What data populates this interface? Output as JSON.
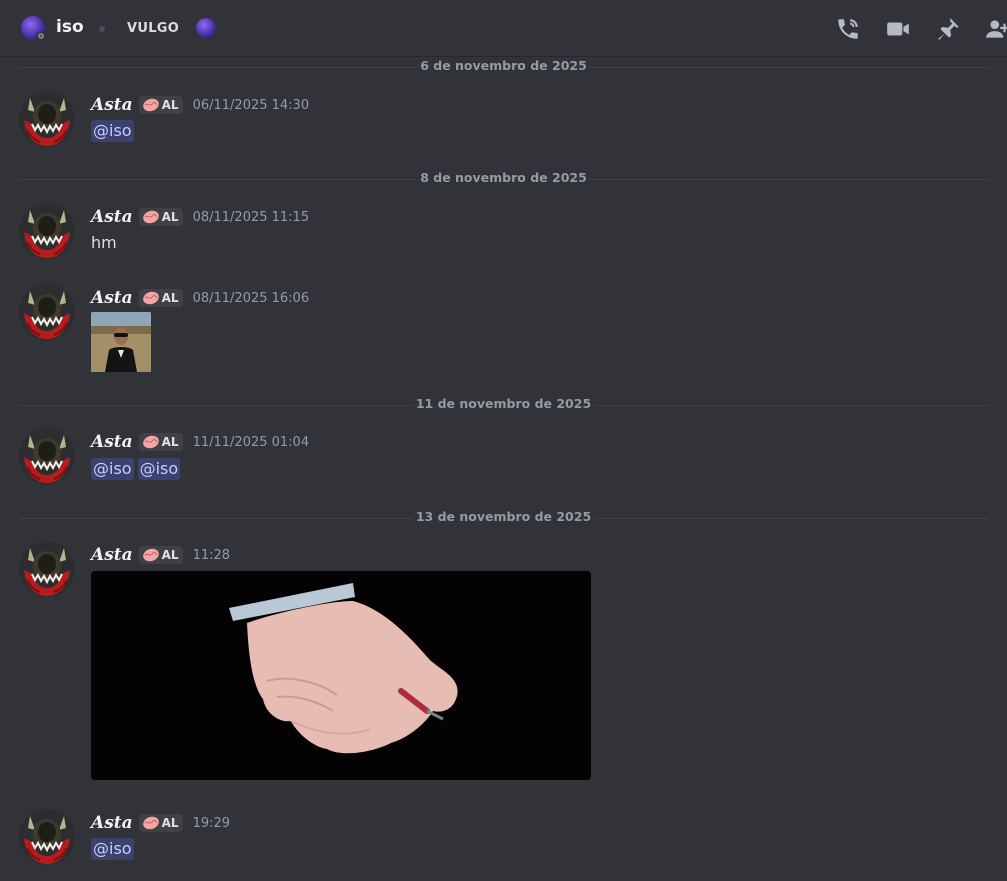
{
  "header": {
    "channel_name": "iso",
    "server_tag": "VULGO",
    "icons": [
      "phone-call-icon",
      "video-camera-icon",
      "pin-icon",
      "add-friends-icon"
    ]
  },
  "colors": {
    "background": "#313338",
    "mention_bg": "#3c4270",
    "mention_text": "#c9cdfb",
    "muted_text": "#949ba4"
  },
  "dividers": [
    "6 de novembro de 2025",
    "8 de novembro de 2025",
    "11 de novembro de 2025",
    "13 de novembro de 2025"
  ],
  "messages": [
    {
      "author": "Asta",
      "tag": "AL",
      "time": "06/11/2025 14:30",
      "mentions": [
        "@iso"
      ]
    },
    {
      "author": "Asta",
      "tag": "AL",
      "time": "08/11/2025 11:15",
      "text": "hm"
    },
    {
      "author": "Asta",
      "tag": "AL",
      "time": "08/11/2025 16:06",
      "attachment": "thumbnail-image"
    },
    {
      "author": "Asta",
      "tag": "AL",
      "time": "11/11/2025 01:04",
      "mentions": [
        "@iso",
        "@iso"
      ]
    },
    {
      "author": "Asta",
      "tag": "AL",
      "time": "11:28",
      "attachment": "hand-image"
    },
    {
      "author": "Asta",
      "tag": "AL",
      "time": "19:29",
      "mentions": [
        "@iso"
      ]
    }
  ]
}
